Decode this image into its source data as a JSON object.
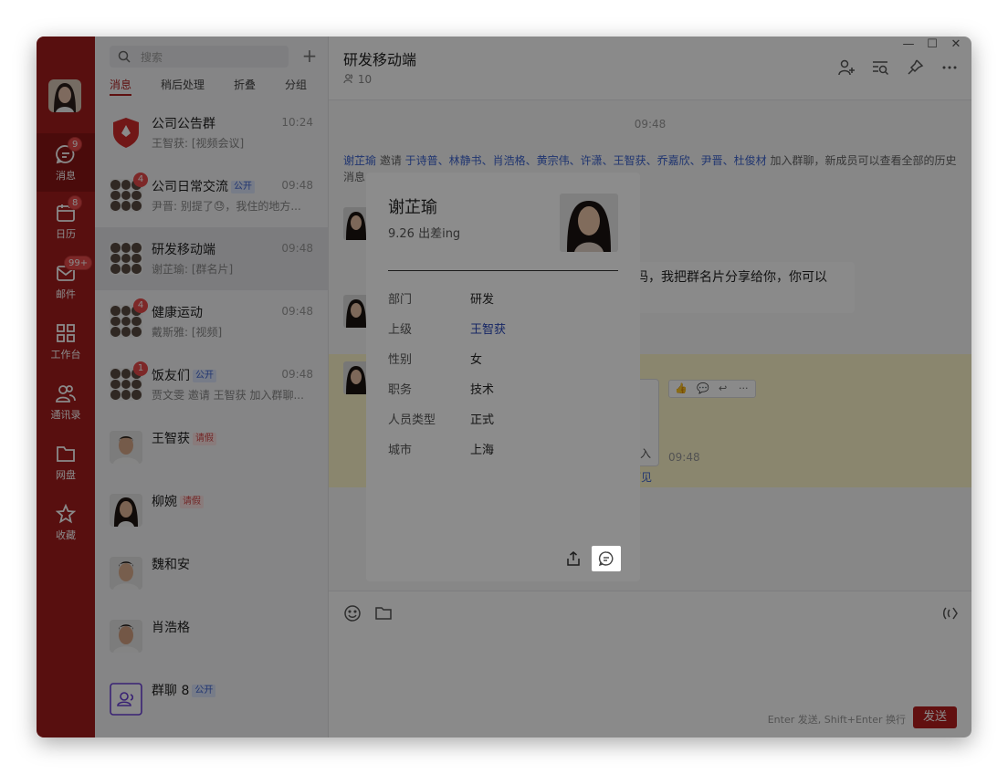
{
  "rail": {
    "items": [
      {
        "label": "消息",
        "badge": "9",
        "icon": "message-icon"
      },
      {
        "label": "日历",
        "badge": "8",
        "icon": "calendar-icon"
      },
      {
        "label": "邮件",
        "badge": "99+",
        "icon": "mail-icon"
      },
      {
        "label": "工作台",
        "badge": "",
        "icon": "workspace-icon"
      },
      {
        "label": "通讯录",
        "badge": "",
        "icon": "contacts-icon"
      },
      {
        "label": "网盘",
        "badge": "",
        "icon": "folder-icon"
      },
      {
        "label": "收藏",
        "badge": "",
        "icon": "star-icon"
      }
    ]
  },
  "list": {
    "search_placeholder": "搜索",
    "tabs": [
      "消息",
      "稍后处理",
      "折叠",
      "分组"
    ],
    "conversations": [
      {
        "name": "公司公告群",
        "time": "10:24",
        "preview": "王智获: [视频会议]",
        "badge": "",
        "tag": ""
      },
      {
        "name": "公司日常交流",
        "time": "09:48",
        "preview": "尹晋: 别提了😓，我住的地方...",
        "badge": "4",
        "tag": "公开"
      },
      {
        "name": "研发移动端",
        "time": "09:48",
        "preview": "谢芷瑜: [群名片]",
        "badge": "",
        "tag": ""
      },
      {
        "name": "健康运动",
        "time": "09:48",
        "preview": "戴斯雅: [视频]",
        "badge": "4",
        "tag": ""
      },
      {
        "name": "饭友们",
        "time": "09:48",
        "preview": "贾文雯 邀请 王智获 加入群聊...",
        "badge": "1",
        "tag": "公开"
      },
      {
        "name": "王智获",
        "time": "",
        "preview": "",
        "badge": "",
        "tag": "请假"
      },
      {
        "name": "柳婉",
        "time": "",
        "preview": "",
        "badge": "",
        "tag": "请假"
      },
      {
        "name": "魏和安",
        "time": "",
        "preview": "",
        "badge": "",
        "tag": ""
      },
      {
        "name": "肖浩格",
        "time": "",
        "preview": "",
        "badge": "",
        "tag": ""
      },
      {
        "name": "群聊 8",
        "time": "",
        "preview": "",
        "badge": "",
        "tag": "公开"
      }
    ]
  },
  "chat": {
    "title": "研发移动端",
    "member_count": "10",
    "time_divider": "09:48",
    "system_message": {
      "inviter": "谢芷瑜",
      "verb": " 邀请 ",
      "invitees": "于诗普、林静书、肖浩格、黄宗伟、许潇、王智获、乔嘉欣、尹晋、杜俊材",
      "rest": " 加入群聊，新成员可以查看全部的历史消息"
    },
    "bubble_text": "吗，我把群名片分享给你，你可以",
    "visible_fragment": "可见",
    "fragment_tail": "入",
    "msg_time": "09:48"
  },
  "composer": {
    "hint": "Enter 发送, Shift+Enter 换行",
    "send_label": "发送"
  },
  "profile": {
    "name": "谢芷瑜",
    "status": "9.26 出差ing",
    "fields": [
      {
        "key": "部门",
        "value": "研发",
        "link": false
      },
      {
        "key": "上级",
        "value": "王智获",
        "link": true
      },
      {
        "key": "性别",
        "value": "女",
        "link": false
      },
      {
        "key": "职务",
        "value": "技术",
        "link": false
      },
      {
        "key": "人员类型",
        "value": "正式",
        "link": false
      },
      {
        "key": "城市",
        "value": "上海",
        "link": false
      }
    ]
  },
  "colors": {
    "brand_red": "#a31d1d",
    "link_blue": "#3b63cf",
    "highlight_yellow": "#fff8cc"
  }
}
